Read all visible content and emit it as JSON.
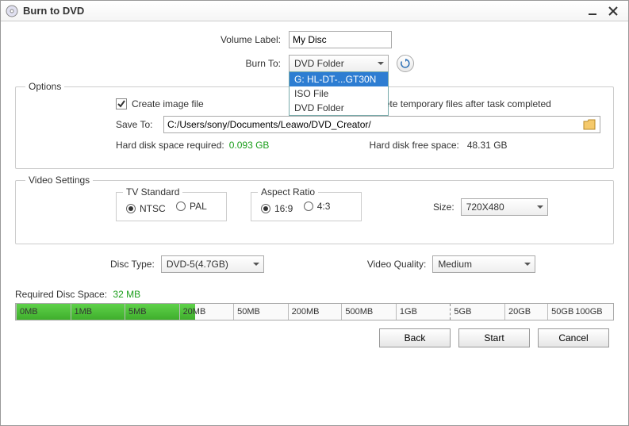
{
  "window": {
    "title": "Burn to DVD"
  },
  "volume": {
    "label": "Volume Label:",
    "value": "My Disc"
  },
  "burnto": {
    "label": "Burn To:",
    "selected": "DVD Folder",
    "options": [
      "G: HL-DT-...GT30N",
      "ISO File",
      "DVD Folder"
    ]
  },
  "options": {
    "legend": "Options",
    "create_image": "Create image file",
    "delete_temp": "Delete temporary files after task completed",
    "saveto_label": "Save To:",
    "saveto_value": "C:/Users/sony/Documents/Leawo/DVD_Creator/",
    "req_label": "Hard disk space required:",
    "req_value": "0.093 GB",
    "free_label": "Hard disk free space:",
    "free_value": "48.31 GB"
  },
  "video": {
    "legend": "Video Settings",
    "tv_legend": "TV Standard",
    "ntsc": "NTSC",
    "pal": "PAL",
    "ar_legend": "Aspect Ratio",
    "ar169": "16:9",
    "ar43": "4:3",
    "size_label": "Size:",
    "size_value": "720X480"
  },
  "disc": {
    "type_label": "Disc Type:",
    "type_value": "DVD-5(4.7GB)",
    "quality_label": "Video Quality:",
    "quality_value": "Medium"
  },
  "required_space": {
    "label": "Required Disc Space:",
    "value": "32 MB"
  },
  "ruler": {
    "ticks": [
      "0MB",
      "1MB",
      "5MB",
      "20MB",
      "50MB",
      "200MB",
      "500MB",
      "1GB",
      "5GB",
      "20GB",
      "50GB",
      "100GB"
    ]
  },
  "buttons": {
    "back": "Back",
    "start": "Start",
    "cancel": "Cancel"
  }
}
